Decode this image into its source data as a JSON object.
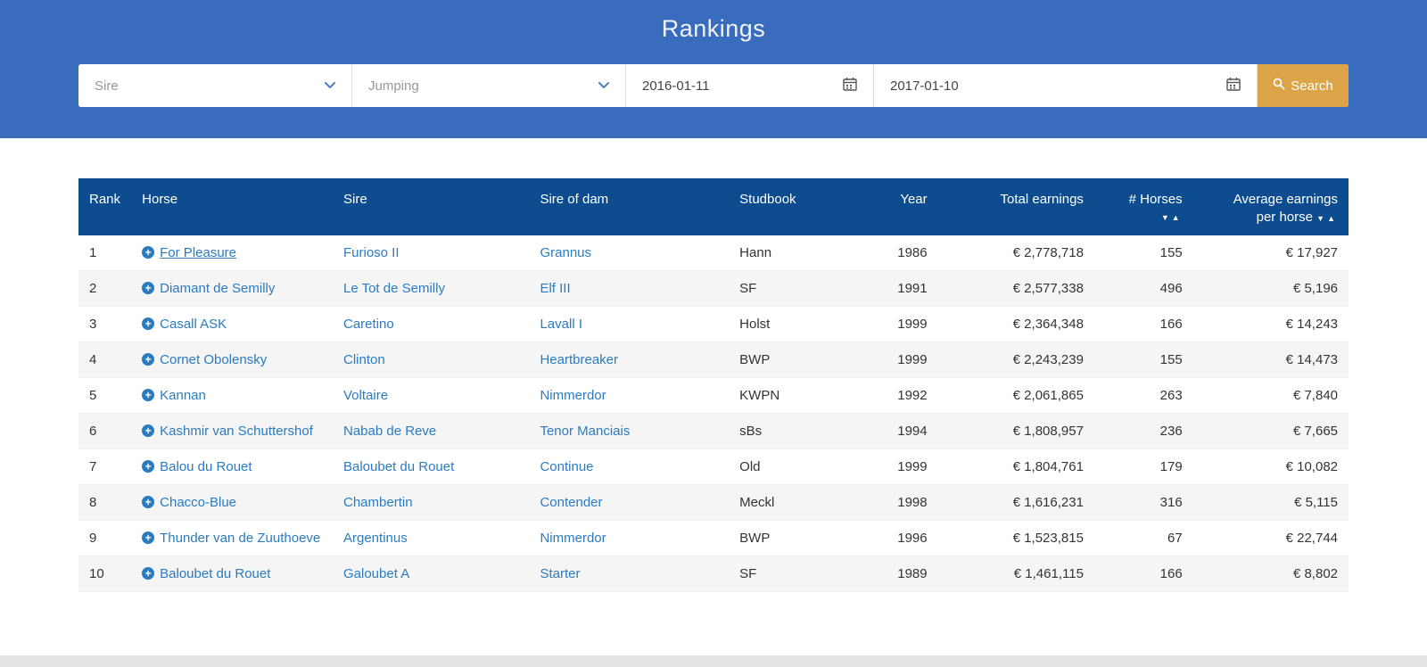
{
  "header": {
    "title": "Rankings"
  },
  "filters": {
    "ranking_type": "Sire",
    "discipline": "Jumping",
    "date_from": "2016-01-11",
    "date_to": "2017-01-10",
    "search_label": "Search"
  },
  "icons": {
    "expand": "+",
    "sort_desc": "▼",
    "sort_asc": "▲"
  },
  "colors": {
    "top_header_blue": "#3a6cbe",
    "table_header_blue": "#0d4c8e",
    "search_button_orange": "#dba449",
    "link_blue": "#2b7bbf"
  },
  "table": {
    "columns": {
      "rank": "Rank",
      "horse": "Horse",
      "sire": "Sire",
      "sire_of_dam": "Sire of dam",
      "studbook": "Studbook",
      "year": "Year",
      "total_earnings": "Total earnings",
      "horses": "# Horses",
      "avg_line1": "Average earnings",
      "avg_line2": "per horse"
    },
    "rows": [
      {
        "rank": "1",
        "horse": "For Pleasure",
        "sire": "Furioso II",
        "sire_of_dam": "Grannus",
        "studbook": "Hann",
        "year": "1986",
        "total_earnings": "€ 2,778,718",
        "horses": "155",
        "avg": "€ 17,927"
      },
      {
        "rank": "2",
        "horse": "Diamant de Semilly",
        "sire": "Le Tot de Semilly",
        "sire_of_dam": "Elf III",
        "studbook": "SF",
        "year": "1991",
        "total_earnings": "€ 2,577,338",
        "horses": "496",
        "avg": "€ 5,196"
      },
      {
        "rank": "3",
        "horse": "Casall ASK",
        "sire": "Caretino",
        "sire_of_dam": "Lavall I",
        "studbook": "Holst",
        "year": "1999",
        "total_earnings": "€ 2,364,348",
        "horses": "166",
        "avg": "€ 14,243"
      },
      {
        "rank": "4",
        "horse": "Cornet Obolensky",
        "sire": "Clinton",
        "sire_of_dam": "Heartbreaker",
        "studbook": "BWP",
        "year": "1999",
        "total_earnings": "€ 2,243,239",
        "horses": "155",
        "avg": "€ 14,473"
      },
      {
        "rank": "5",
        "horse": "Kannan",
        "sire": "Voltaire",
        "sire_of_dam": "Nimmerdor",
        "studbook": "KWPN",
        "year": "1992",
        "total_earnings": "€ 2,061,865",
        "horses": "263",
        "avg": "€ 7,840"
      },
      {
        "rank": "6",
        "horse": "Kashmir van Schuttershof",
        "sire": "Nabab de Reve",
        "sire_of_dam": "Tenor Manciais",
        "studbook": "sBs",
        "year": "1994",
        "total_earnings": "€ 1,808,957",
        "horses": "236",
        "avg": "€ 7,665"
      },
      {
        "rank": "7",
        "horse": "Balou du Rouet",
        "sire": "Baloubet du Rouet",
        "sire_of_dam": "Continue",
        "studbook": "Old",
        "year": "1999",
        "total_earnings": "€ 1,804,761",
        "horses": "179",
        "avg": "€ 10,082"
      },
      {
        "rank": "8",
        "horse": "Chacco-Blue",
        "sire": "Chambertin",
        "sire_of_dam": "Contender",
        "studbook": "Meckl",
        "year": "1998",
        "total_earnings": "€ 1,616,231",
        "horses": "316",
        "avg": "€ 5,115"
      },
      {
        "rank": "9",
        "horse": "Thunder van de Zuuthoeve",
        "sire": "Argentinus",
        "sire_of_dam": "Nimmerdor",
        "studbook": "BWP",
        "year": "1996",
        "total_earnings": "€ 1,523,815",
        "horses": "67",
        "avg": "€ 22,744"
      },
      {
        "rank": "10",
        "horse": "Baloubet du Rouet",
        "sire": "Galoubet A",
        "sire_of_dam": "Starter",
        "studbook": "SF",
        "year": "1989",
        "total_earnings": "€ 1,461,115",
        "horses": "166",
        "avg": "€ 8,802"
      }
    ]
  }
}
